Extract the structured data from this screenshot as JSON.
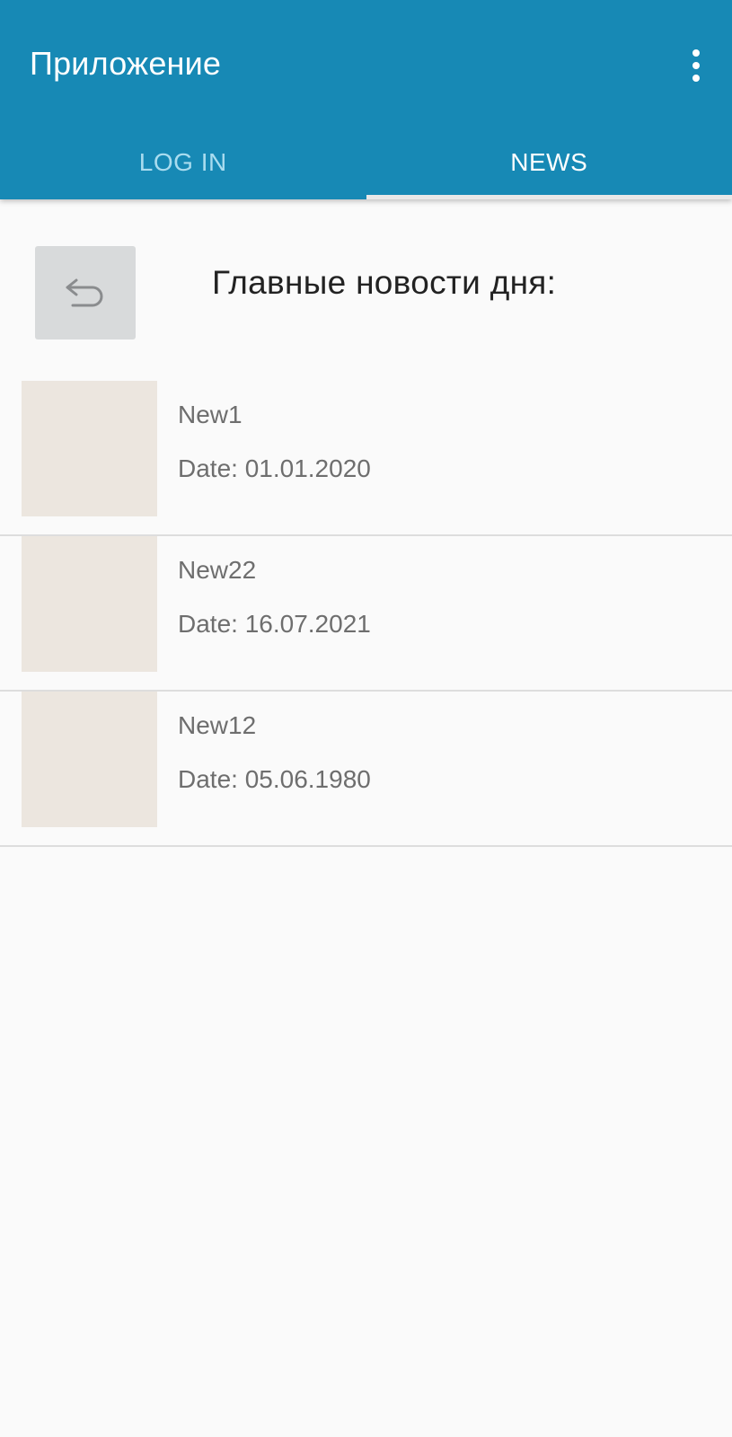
{
  "app_bar": {
    "title": "Приложение",
    "overflow_icon": "more-vert-icon",
    "background": "#1789b5"
  },
  "tabs": [
    {
      "label": "LOG IN",
      "selected": false
    },
    {
      "label": "NEWS",
      "selected": true
    }
  ],
  "page": {
    "back_icon": "undo-back-icon",
    "heading": "Главные новости дня:"
  },
  "news": [
    {
      "title": "New1",
      "date": "Date: 01.01.2020"
    },
    {
      "title": "New22",
      "date": "Date: 16.07.2021"
    },
    {
      "title": "New12",
      "date": "Date: 05.06.1980"
    }
  ]
}
